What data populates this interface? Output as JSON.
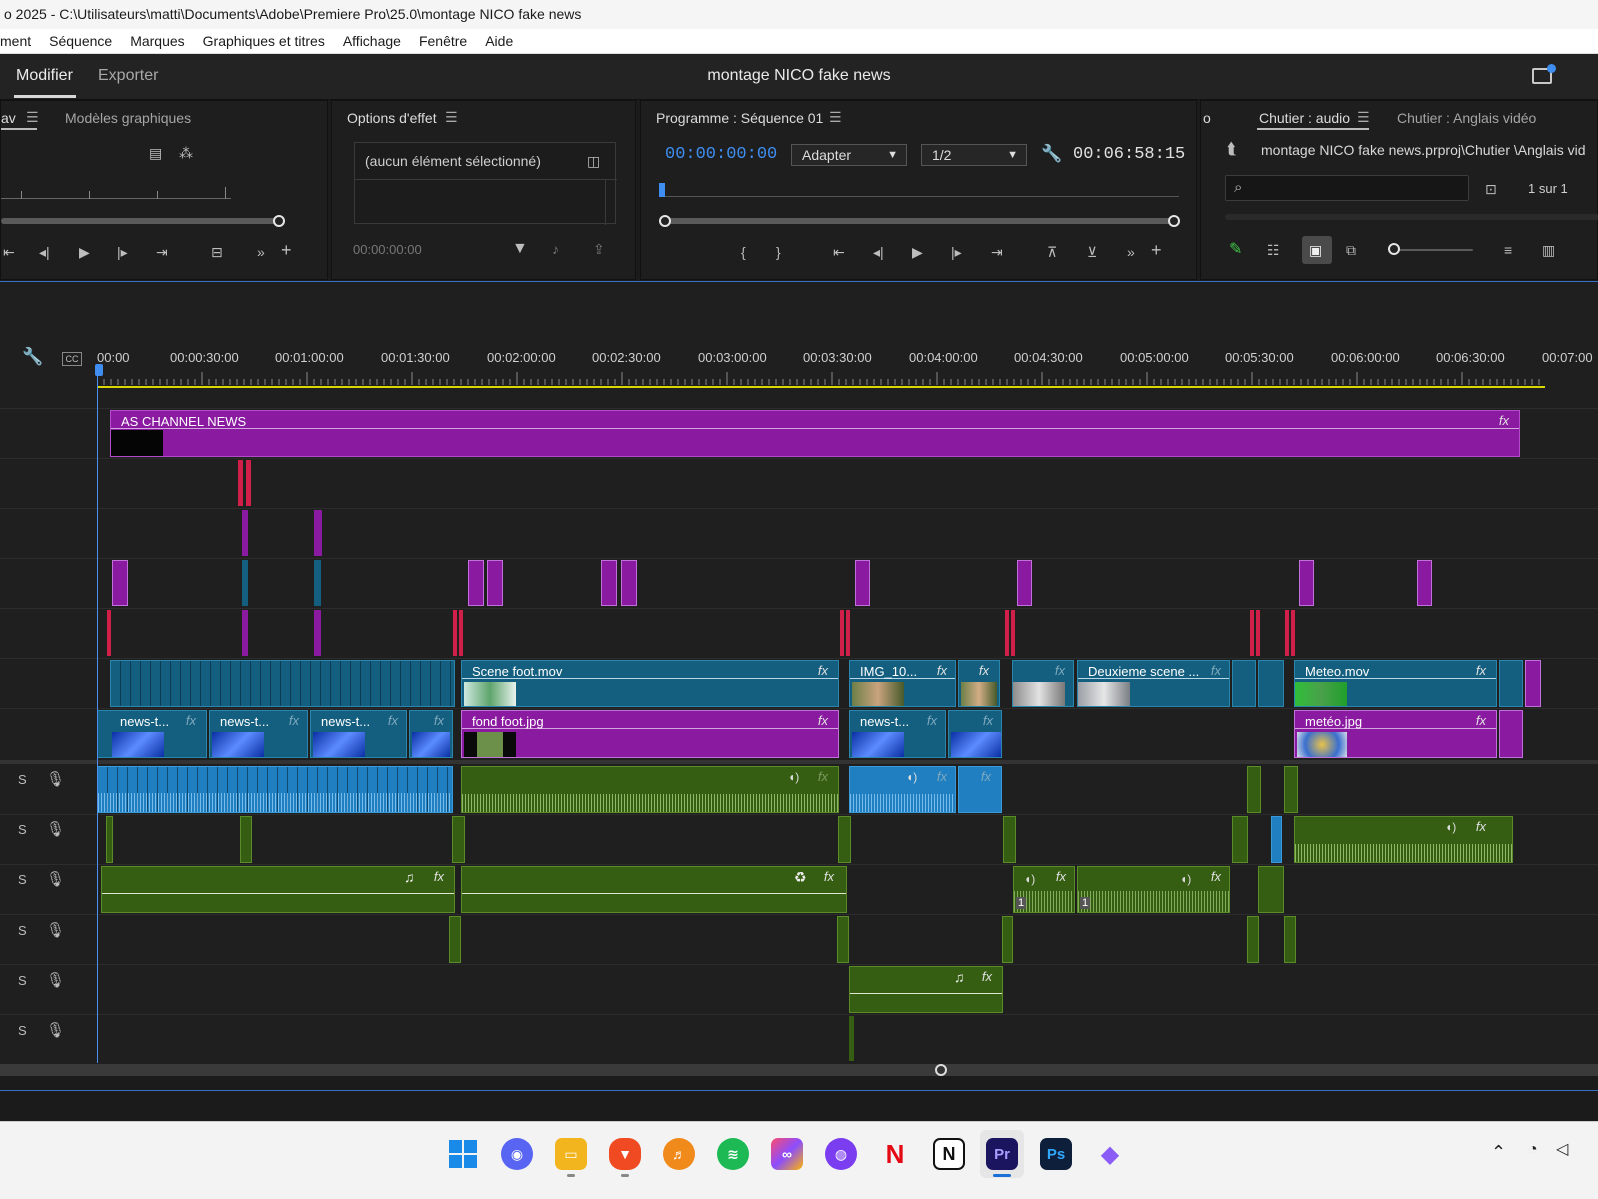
{
  "window": {
    "title": "o 2025 - C:\\Utilisateurs\\matti\\Documents\\Adobe\\Premiere Pro\\25.0\\montage NICO fake news"
  },
  "menu": [
    "ment",
    "Séquence",
    "Marques",
    "Graphiques et titres",
    "Affichage",
    "Fenêtre",
    "Aide"
  ],
  "header": {
    "tab_modifier": "Modifier",
    "tab_exporter": "Exporter",
    "project_title": "montage NICO fake news"
  },
  "source_panel": {
    "tab_partial": "av",
    "tab_models": "Modèles graphiques"
  },
  "effect_panel": {
    "tab": "Options d'effet",
    "no_selection": "(aucun élément sélectionné)",
    "timecode": "00:00:00:00"
  },
  "program_panel": {
    "tab": "Programme : Séquence 01",
    "timecode_current": "00:00:00:00",
    "fit": "Adapter",
    "resolution": "1/2",
    "timecode_duration": "00:06:58:15"
  },
  "bin_panel": {
    "tab_partial": "o",
    "tab_audio": "Chutier : audio",
    "tab_english": "Chutier : Anglais vidéo",
    "path": "montage NICO fake news.prproj\\Chutier \\Anglais vid",
    "count": "1 sur 1",
    "search_placeholder": ""
  },
  "timeline": {
    "ruler_labels": [
      "00:00",
      "00:00:30:00",
      "00:01:00:00",
      "00:01:30:00",
      "00:02:00:00",
      "00:02:30:00",
      "00:03:00:00",
      "00:03:30:00",
      "00:04:00:00",
      "00:04:30:00",
      "00:05:00:00",
      "00:05:30:00",
      "00:06:00:00",
      "00:06:30:00",
      "00:07:00"
    ],
    "audio_track_solo": "S",
    "clips": {
      "as_channel": "AS CHANNEL NEWS",
      "scene_foot": "Scene foot.mov",
      "img10": "IMG_10...",
      "deuxieme": "Deuxieme scene ...",
      "meteo_mov": "Meteo.mov",
      "news_t": "news-t...",
      "fond_foot": "fond foot.jpg",
      "meteo_jpg": "metéo.jpg",
      "fx": "fx",
      "keyframe_num": "1"
    },
    "colors": {
      "purple": "#8a1aa0",
      "teal": "#145f7f",
      "green": "#355e12",
      "blue_audio": "#1f7fc0",
      "red_marker": "#d0204a"
    }
  },
  "taskbar": {
    "icons": [
      "windows-start",
      "discord",
      "file-explorer",
      "brave",
      "fl-studio",
      "spotify",
      "creative-cloud",
      "media-app",
      "netflix",
      "notion",
      "premiere-pro",
      "photoshop",
      "obsidian"
    ],
    "premiere_label": "Pr",
    "photoshop_label": "Ps",
    "notion_label": "N"
  }
}
